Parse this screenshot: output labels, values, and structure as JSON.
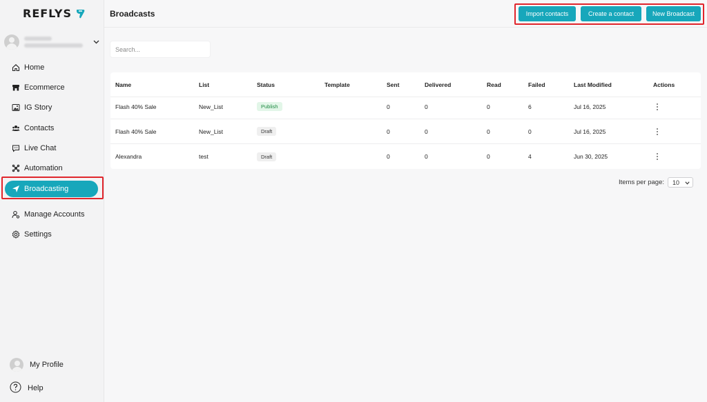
{
  "app": {
    "logo_text": "REFLYS",
    "brand_color": "#17a7bb",
    "highlight_color": "#e0242b"
  },
  "sidebar": {
    "items": [
      {
        "label": "Home",
        "icon": "home-icon"
      },
      {
        "label": "Ecommerce",
        "icon": "store-icon"
      },
      {
        "label": "IG Story",
        "icon": "image-icon"
      },
      {
        "label": "Contacts",
        "icon": "users-icon"
      },
      {
        "label": "Live Chat",
        "icon": "chat-icon"
      },
      {
        "label": "Automation",
        "icon": "automation-icon"
      },
      {
        "label": "Broadcasting",
        "icon": "send-icon",
        "active": true
      },
      {
        "label": "Manage Accounts",
        "icon": "user-settings-icon"
      },
      {
        "label": "Settings",
        "icon": "gear-icon"
      }
    ],
    "profile_label": "My Profile",
    "help_label": "Help"
  },
  "header": {
    "title": "Broadcasts",
    "buttons": {
      "import": "Import contacts",
      "create": "Create a contact",
      "new": "New Broadcast"
    }
  },
  "search": {
    "placeholder": "Search..."
  },
  "table": {
    "columns": [
      "Name",
      "List",
      "Status",
      "Template",
      "Sent",
      "Delivered",
      "Read",
      "Failed",
      "Last Modified",
      "Actions"
    ],
    "rows": [
      {
        "name": "Flash 40% Sale",
        "list": "New_List",
        "status": "Publish",
        "template": "",
        "sent": "0",
        "delivered": "0",
        "read": "0",
        "failed": "6",
        "modified": "Jul 16, 2025"
      },
      {
        "name": "Flash 40% Sale",
        "list": "New_List",
        "status": "Draft",
        "template": "",
        "sent": "0",
        "delivered": "0",
        "read": "0",
        "failed": "0",
        "modified": "Jul 16, 2025"
      },
      {
        "name": "Alexandra",
        "list": "test",
        "status": "Draft",
        "template": "",
        "sent": "0",
        "delivered": "0",
        "read": "0",
        "failed": "4",
        "modified": "Jun 30, 2025"
      }
    ]
  },
  "pagination": {
    "label": "Items per page:",
    "value": "10"
  }
}
